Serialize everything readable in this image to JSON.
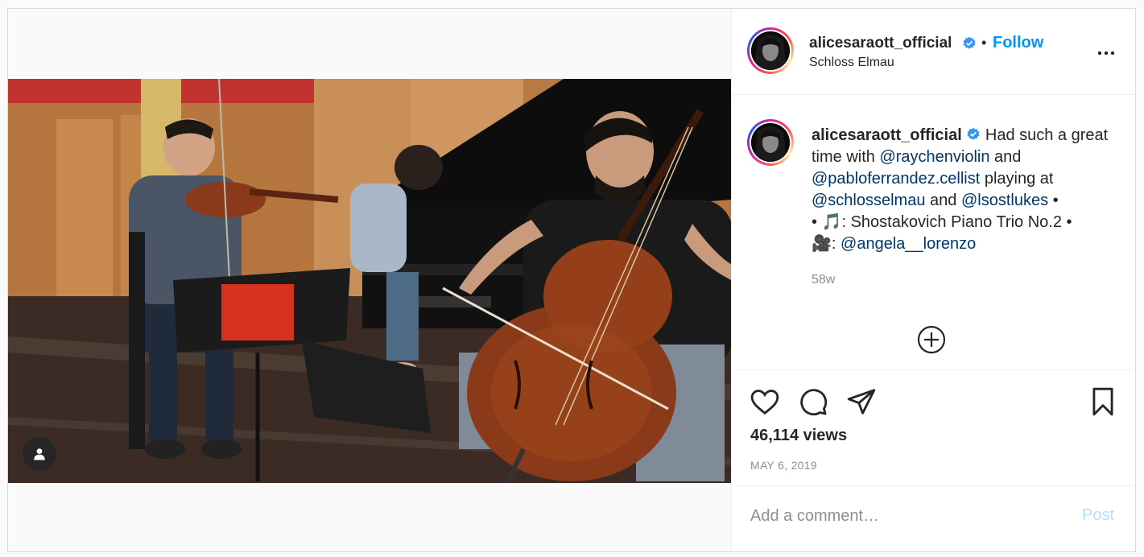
{
  "header": {
    "username": "alicesaraott_official",
    "separator": "•",
    "follow_label": "Follow",
    "location": "Schloss Elmau",
    "more_icon": "more-horizontal-icon"
  },
  "caption": {
    "username": "alicesaraott_official",
    "text_1": "Had such a great time with ",
    "mention_1": "@raychenviolin",
    "text_2": " and ",
    "mention_2": "@pabloferrandez.cellist",
    "text_3": " playing at ",
    "mention_3": "@schlosselmau",
    "text_4": " and ",
    "mention_4": "@lsostlukes",
    "text_5": " •",
    "line_2_prefix": "• ",
    "music_emoji": "🎵",
    "line_2_text": ": Shostakovich Piano Trio No.2 •",
    "camera_emoji": "🎥",
    "line_3_text": ": ",
    "mention_5": "@angela__lorenzo",
    "time_ago": "58w"
  },
  "actions": {
    "like_icon": "heart-icon",
    "comment_icon": "comment-icon",
    "share_icon": "paper-plane-icon",
    "save_icon": "bookmark-icon",
    "views": "46,114 views",
    "date": "MAY 6, 2019"
  },
  "comment": {
    "placeholder": "Add a comment…",
    "post_label": "Post"
  },
  "colors": {
    "accent": "#0095f6",
    "mention": "#00376b",
    "muted": "#8e8e8e",
    "post_disabled": "#b2dffc",
    "verified": "#3897f0"
  }
}
